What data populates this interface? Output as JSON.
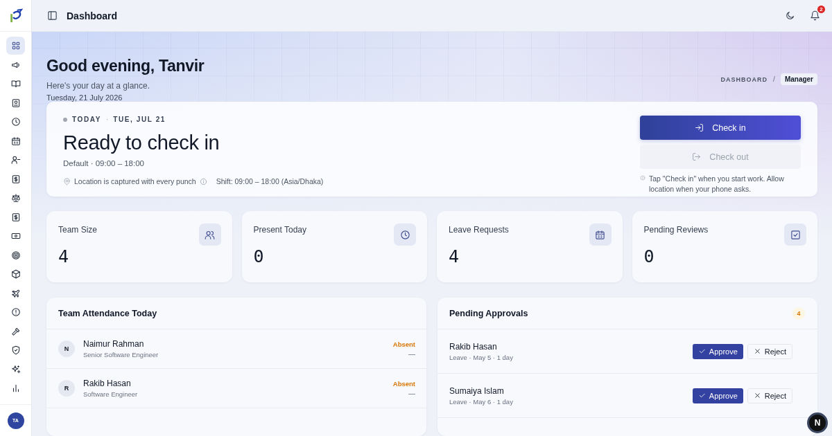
{
  "sidebar": {
    "items": [
      {
        "kind": "grid",
        "selected": true
      },
      {
        "kind": "megaphone",
        "selected": false
      },
      {
        "kind": "book",
        "selected": false
      },
      {
        "kind": "contact",
        "selected": false
      },
      {
        "kind": "clock",
        "selected": false
      },
      {
        "kind": "calendar",
        "selected": false
      },
      {
        "kind": "user-minus",
        "selected": false
      },
      {
        "kind": "dollar",
        "selected": false
      },
      {
        "kind": "scale",
        "selected": false
      },
      {
        "kind": "dollar",
        "selected": false
      },
      {
        "kind": "banknote",
        "selected": false
      },
      {
        "kind": "target",
        "selected": false
      },
      {
        "kind": "box",
        "selected": false
      },
      {
        "kind": "plane",
        "selected": false
      },
      {
        "kind": "alert",
        "selected": false
      },
      {
        "kind": "hammer",
        "selected": false
      },
      {
        "kind": "shield",
        "selected": false
      },
      {
        "kind": "sparkles",
        "selected": false
      },
      {
        "kind": "chart",
        "selected": false
      }
    ],
    "avatar": "TA"
  },
  "topbar": {
    "title": "Dashboard",
    "notification_count": "2"
  },
  "hero": {
    "greeting": "Good evening, Tanvir",
    "subtitle": "Here's your day at a glance.",
    "date": "Tuesday, 21 July 2026",
    "breadcrumb": "DASHBOARD",
    "separator": "/",
    "role": "Manager"
  },
  "checkin": {
    "today": "TODAY",
    "dot": "·",
    "day": "TUE, JUL 21",
    "status": "Ready to check in",
    "schedule": "Default · 09:00 – 18:00",
    "location_note": "Location is captured with every punch",
    "shift": "Shift: 09:00 – 18:00 (Asia/Dhaka)",
    "buttons": [
      {
        "kind": "checkin",
        "label": "Check in",
        "disabled": false
      },
      {
        "kind": "checkout",
        "label": "Check out",
        "disabled": true
      }
    ],
    "hint": "Tap \"Check in\" when you start work. Allow location when your phone asks."
  },
  "stats": [
    {
      "label": "Team Size",
      "value": "4",
      "kind": "users"
    },
    {
      "label": "Present Today",
      "value": "0",
      "kind": "clock"
    },
    {
      "label": "Leave Requests",
      "value": "4",
      "kind": "calendar"
    },
    {
      "label": "Pending Reviews",
      "value": "0",
      "kind": "check-square"
    }
  ],
  "attendance": {
    "title": "Team Attendance Today",
    "rows": [
      {
        "initial": "N",
        "name": "Naimur Rahman",
        "role": "Senior Software Engineer",
        "status": "Absent",
        "time": "—",
        "color": "#d97706"
      },
      {
        "initial": "R",
        "name": "Rakib Hasan",
        "role": "Software Engineer",
        "status": "Absent",
        "time": "—",
        "color": "#d97706"
      }
    ]
  },
  "approvals": {
    "title": "Pending Approvals",
    "count": "4",
    "rows": [
      {
        "name": "Rakib Hasan",
        "detail": "Leave · May 5 · 1 day",
        "approve": "Approve",
        "reject": "Reject"
      },
      {
        "name": "Sumaiya Islam",
        "detail": "Leave · May 6 · 1 day",
        "approve": "Approve",
        "reject": "Reject"
      }
    ]
  },
  "dev_indicator": "N"
}
